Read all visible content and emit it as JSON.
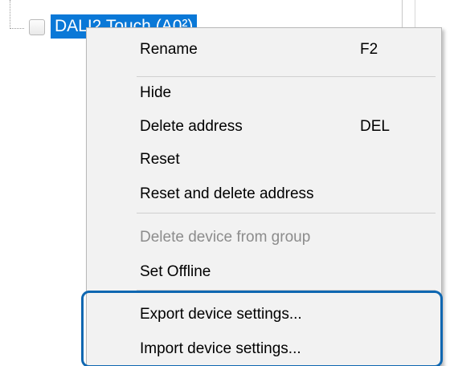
{
  "tree": {
    "selected_item_label": "DALI2 Touch (A0²)"
  },
  "context_menu": {
    "items": [
      {
        "label": "Rename",
        "shortcut": "F2",
        "enabled": true
      },
      {
        "label": "Hide",
        "shortcut": "",
        "enabled": true
      },
      {
        "label": "Delete address",
        "shortcut": "DEL",
        "enabled": true
      },
      {
        "label": "Reset",
        "shortcut": "",
        "enabled": true
      },
      {
        "label": "Reset and delete address",
        "shortcut": "",
        "enabled": true
      },
      {
        "label": "Delete device from group",
        "shortcut": "",
        "enabled": false
      },
      {
        "label": "Set Offline",
        "shortcut": "",
        "enabled": true
      },
      {
        "label": "Export device settings...",
        "shortcut": "",
        "enabled": true
      },
      {
        "label": "Import device settings...",
        "shortcut": "",
        "enabled": true
      }
    ]
  },
  "colors": {
    "selection": "#0a78d7",
    "highlight_outline": "#0f67b1",
    "menu_background": "#f2f2f2",
    "disabled_text": "#8c8c8c"
  }
}
